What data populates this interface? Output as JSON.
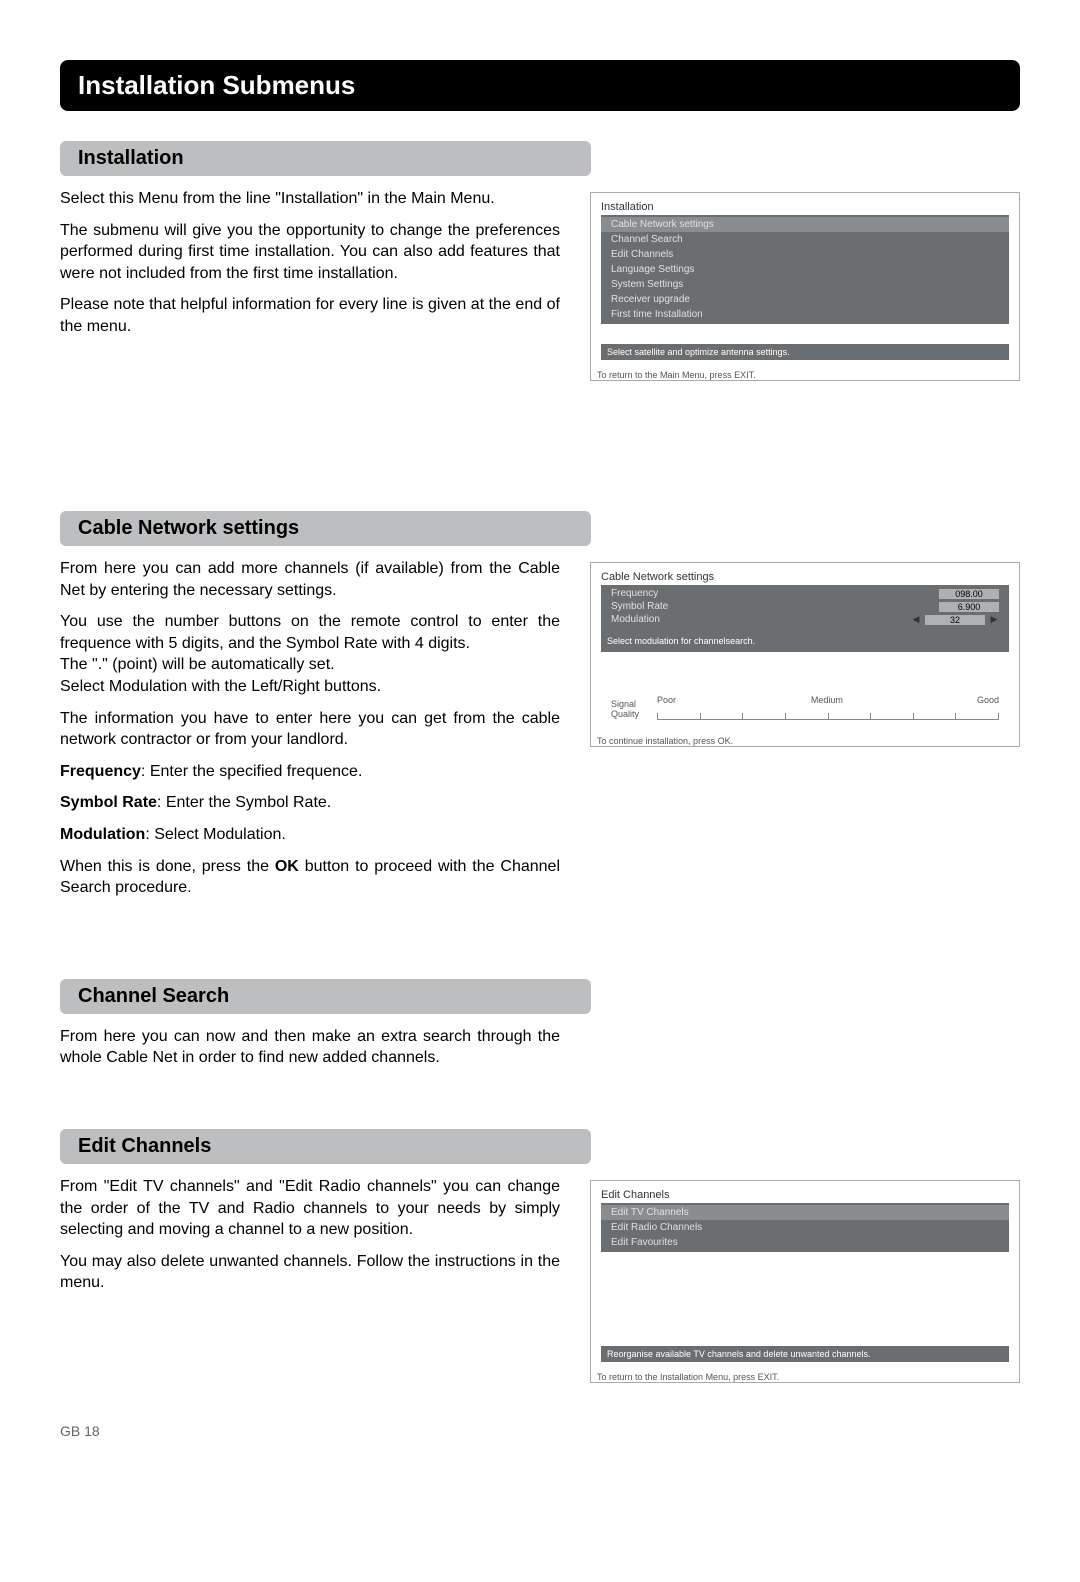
{
  "pageTitle": "Installation Submenus",
  "pageNumber": "GB 18",
  "sections": {
    "installation": {
      "heading": "Installation",
      "p1": "Select this Menu from the line \"Installation\" in the Main Menu.",
      "p2": "The submenu will give you the opportunity to change the preferences performed during first time installation. You can also add features that were not included from the first time installation.",
      "p3": "Please note that helpful information for every line is given at the end of the menu."
    },
    "cable": {
      "heading": "Cable Network settings",
      "p1": "From here you can add more channels (if available) from the Cable Net by entering the necessary settings.",
      "p2a": "You use the number buttons on the remote control to enter the frequence with 5 digits, and the Symbol Rate with 4 digits.",
      "p2b": "The \".\" (point) will be automatically set.",
      "p2c": "Select Modulation with the Left/Right buttons.",
      "p3": "The information you have to enter here you can get from the cable network contractor or from your landlord.",
      "freqLabel": "Frequency",
      "freqText": ": Enter the specified frequence.",
      "srLabel": "Symbol Rate",
      "srText": ": Enter the Symbol Rate.",
      "modLabel": "Modulation",
      "modText": ": Select Modulation.",
      "p4a": "When this is done, press the ",
      "p4b": "OK",
      "p4c": " button to proceed with the Channel Search procedure."
    },
    "search": {
      "heading": "Channel Search",
      "p1": "From here you can now and then make an extra search through the whole Cable Net in order to find new added channels."
    },
    "edit": {
      "heading": "Edit Channels",
      "p1": "From \"Edit TV channels\" and \"Edit Radio channels\" you can change the order of the TV and Radio channels to your needs by simply selecting and moving a channel to a new position.",
      "p2": "You may also delete unwanted channels. Follow the instructions in the menu."
    }
  },
  "screenshots": {
    "install": {
      "title": "Installation",
      "items": [
        "Cable Network settings",
        "Channel Search",
        "Edit Channels",
        "Language Settings",
        "System Settings",
        "Receiver upgrade",
        "First time Installation"
      ],
      "hint": "Select satellite and optimize antenna settings.",
      "footer": "To return to the Main Menu, press EXIT."
    },
    "cable": {
      "title": "Cable Network settings",
      "freqLabel": "Frequency",
      "freqVal": "098.00",
      "srLabel": "Symbol Rate",
      "srVal": "6.900",
      "modLabel": "Modulation",
      "modVal": "32",
      "hint": "Select modulation for channelsearch.",
      "signalLabel1": "Signal",
      "signalLabel2": "Quality",
      "tickPoor": "Poor",
      "tickMedium": "Medium",
      "tickGood": "Good",
      "footer": "To continue installation, press OK."
    },
    "edit": {
      "title": "Edit Channels",
      "items": [
        "Edit TV Channels",
        "Edit Radio Channels",
        "Edit Favourites"
      ],
      "hint": "Reorganise available TV channels and delete unwanted channels.",
      "footer": "To return to the Installation Menu, press EXIT."
    }
  }
}
